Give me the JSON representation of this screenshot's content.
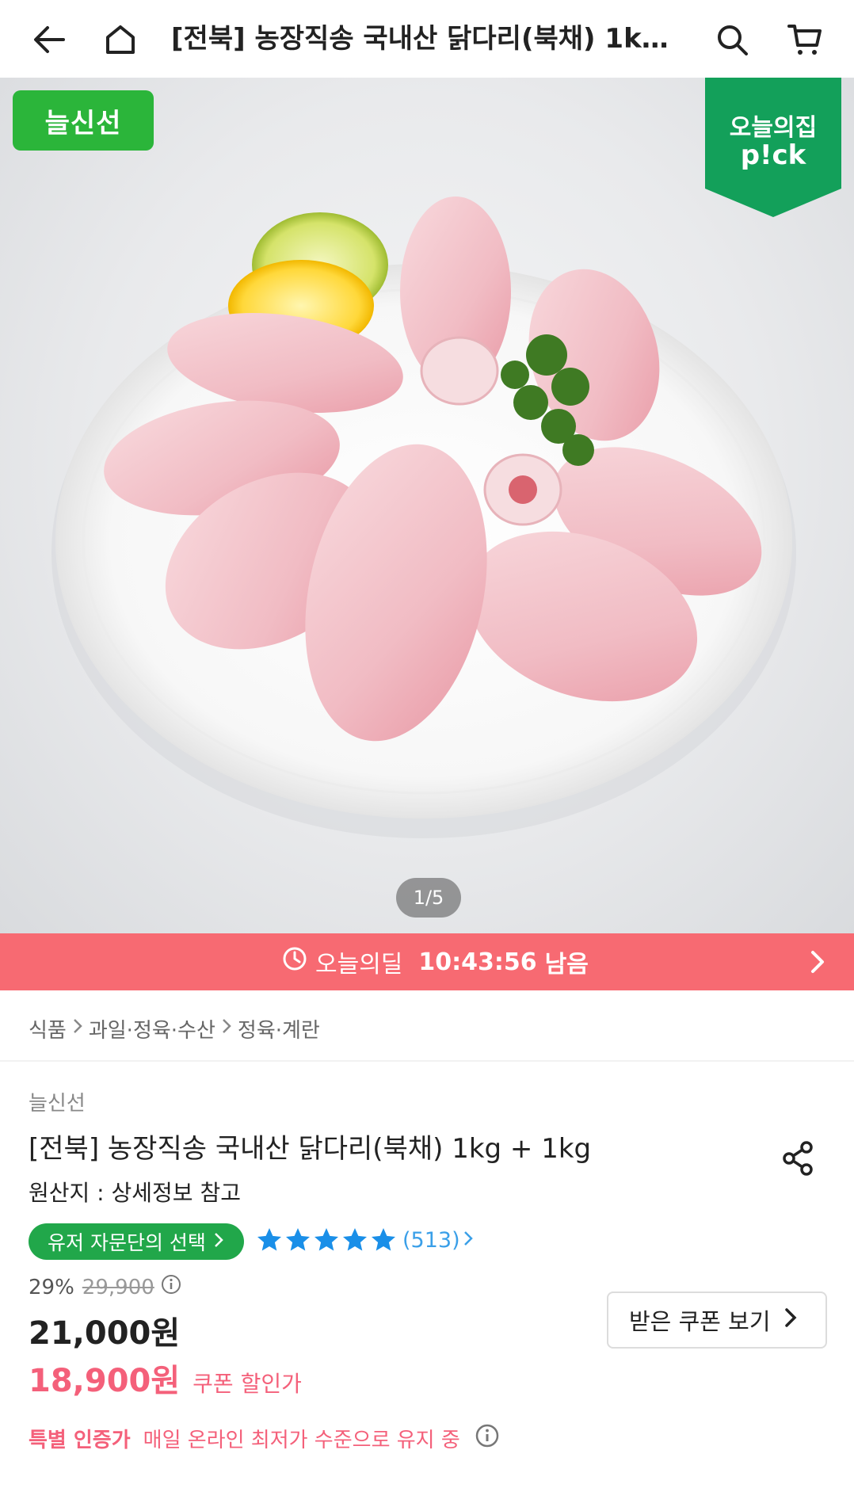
{
  "header": {
    "title": "[전북] 농장직송 국내산 닭다리(북채) 1kg + 1kg",
    "icons": [
      "back-arrow-icon",
      "home-icon",
      "search-icon",
      "cart-icon"
    ]
  },
  "hero": {
    "brand_badge": "늘신선",
    "pick_badge_line1": "오늘의집",
    "pick_badge_line2": "p!ck",
    "image_counter": "1/5"
  },
  "deal": {
    "label": "오늘의딜",
    "time_left": "10:43:56",
    "suffix": "남음"
  },
  "breadcrumb": {
    "items": [
      "식품",
      "과일·정육·수산",
      "정육·계란"
    ]
  },
  "product": {
    "brand": "늘신선",
    "title": "[전북] 농장직송 국내산 닭다리(북채) 1kg + 1kg",
    "origin": "원산지 : 상세정보 참고",
    "user_pick_label": "유저 자문단의 선택",
    "rating": 5,
    "review_count": "(513)",
    "discount_percent": "29%",
    "original_price": "29,900",
    "price": "21,000원",
    "coupon_price": "18,900원",
    "coupon_price_label": "쿠폰 할인가",
    "coupon_button": "받은 쿠폰 보기",
    "special_label": "특별 인증가",
    "special_desc": "매일 온라인 최저가 수준으로 유지 중"
  },
  "colors": {
    "brand_green": "#2bb53a",
    "pick_green": "#13a05a",
    "deal_bar": "#f76a72",
    "coupon_pink": "#f4607a",
    "star_blue": "#1a8fe8"
  }
}
